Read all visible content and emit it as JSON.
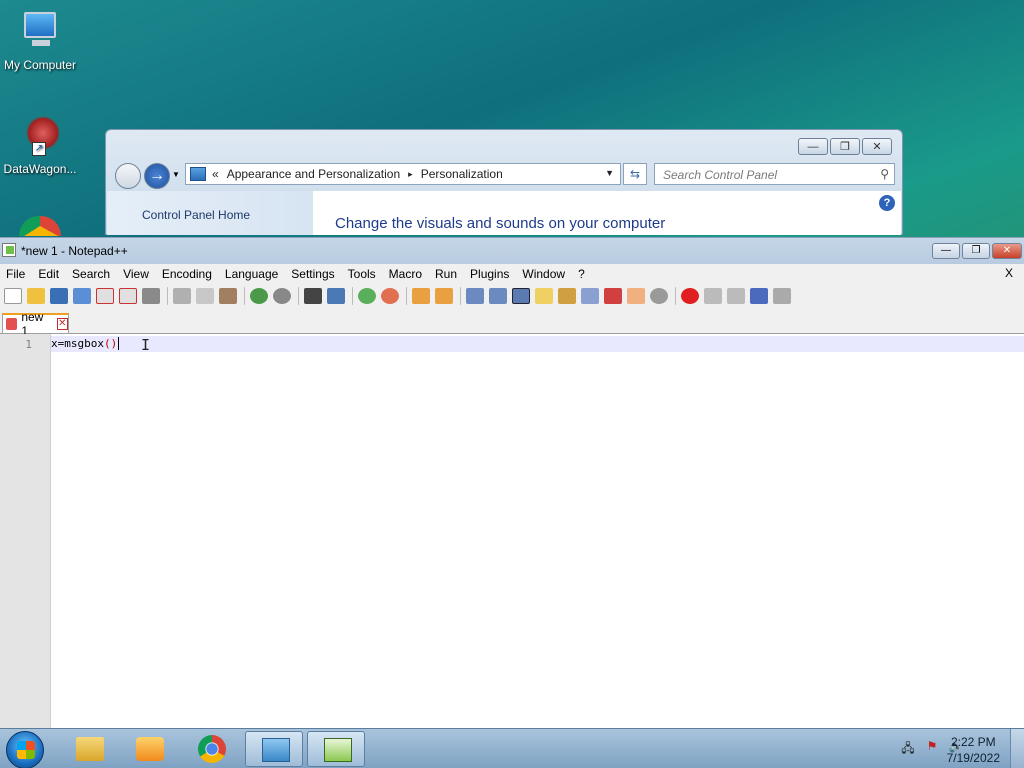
{
  "desktop": {
    "icons": [
      {
        "label": "My Computer",
        "icon": "computer-icon"
      },
      {
        "label": "DataWagon...",
        "icon": "shortcut-icon"
      }
    ]
  },
  "control_panel": {
    "breadcrumb": {
      "prefix": "«",
      "items": [
        "Appearance and Personalization",
        "Personalization"
      ],
      "separator": "▸"
    },
    "search_placeholder": "Search Control Panel",
    "left_nav": {
      "home": "Control Panel Home"
    },
    "heading": "Change the visuals and sounds on your computer",
    "caption_buttons": [
      "—",
      "❐",
      "✕"
    ],
    "help": "?"
  },
  "notepad": {
    "title": "*new 1 - Notepad++",
    "menu": [
      "File",
      "Edit",
      "Search",
      "View",
      "Encoding",
      "Language",
      "Settings",
      "Tools",
      "Macro",
      "Run",
      "Plugins",
      "Window",
      "?"
    ],
    "menu_close": "X",
    "tab": {
      "label": "new 1",
      "close": "✕"
    },
    "editor": {
      "line_number": "1",
      "code_prefix": "x=msgbox",
      "code_parens": "()"
    }
  },
  "taskbar": {
    "clock": {
      "time": "2:22 PM",
      "date": "7/19/2022"
    },
    "colors": {
      "accent": "#1a6fc0",
      "active_button": "#9fbcd8"
    }
  }
}
